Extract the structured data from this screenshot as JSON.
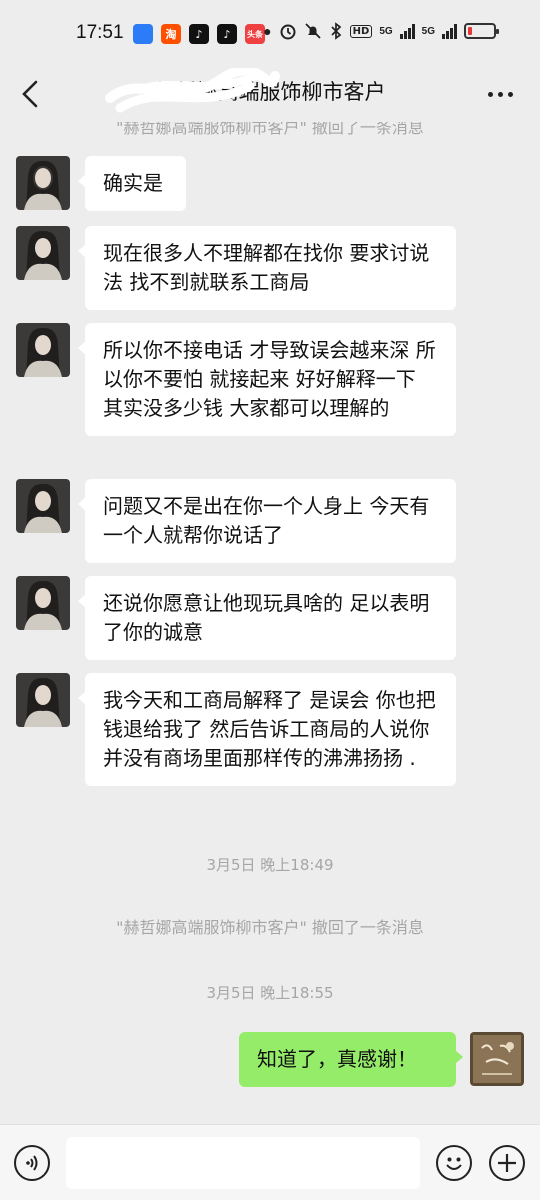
{
  "status_bar": {
    "time": "17:51",
    "app_icons": [
      {
        "name": "blue-app-icon",
        "glyph": "",
        "color": "#2b7cf6"
      },
      {
        "name": "taobao-icon",
        "glyph": "淘",
        "color": "#ff5000"
      },
      {
        "name": "douyin-icon",
        "glyph": "♪",
        "color": "#111111"
      },
      {
        "name": "douyin-icon",
        "glyph": "♪",
        "color": "#111111"
      },
      {
        "name": "toutiao-icon",
        "glyph": "头条",
        "color": "#f04142"
      }
    ],
    "network_badge": "HD",
    "net1": "5G",
    "net2": "5G"
  },
  "navbar": {
    "title": "赫哲娜高端服饰柳市客户"
  },
  "messages": [
    {
      "kind": "system",
      "text": "\"赫哲娜高端服饰柳市客户\" 撤回了一条消息"
    },
    {
      "kind": "received",
      "text": "确实是"
    },
    {
      "kind": "received",
      "text": "现在很多人不理解都在找你 要求讨说法 找不到就联系工商局"
    },
    {
      "kind": "received",
      "text": "所以你不接电话 才导致误会越来深 所以你不要怕 就接起来 好好解释一下 其实没多少钱 大家都可以理解的"
    },
    {
      "kind": "received",
      "text": "问题又不是出在你一个人身上 今天有一个人就帮你说话了"
    },
    {
      "kind": "received",
      "text": "还说你愿意让他现玩具啥的 足以表明了你的诚意"
    },
    {
      "kind": "received",
      "text": "我今天和工商局解释了 是误会 你也把钱退给我了 然后告诉工商局的人说你并没有商场里面那样传的沸沸扬扬 ."
    },
    {
      "kind": "timestamp",
      "text": "3月5日 晚上18:49"
    },
    {
      "kind": "system",
      "text": "\"赫哲娜高端服饰柳市客户\" 撤回了一条消息"
    },
    {
      "kind": "timestamp",
      "text": "3月5日 晚上18:55"
    },
    {
      "kind": "sent",
      "text": "知道了，真感谢！"
    }
  ],
  "colors": {
    "background": "#ededed",
    "bubble_received": "#ffffff",
    "bubble_sent": "#95ec69",
    "system_text": "#a6a6a6",
    "battery_low": "#e53935"
  },
  "input_bar": {
    "icons": [
      "voice-icon",
      "emoji-icon",
      "plus-icon"
    ]
  }
}
